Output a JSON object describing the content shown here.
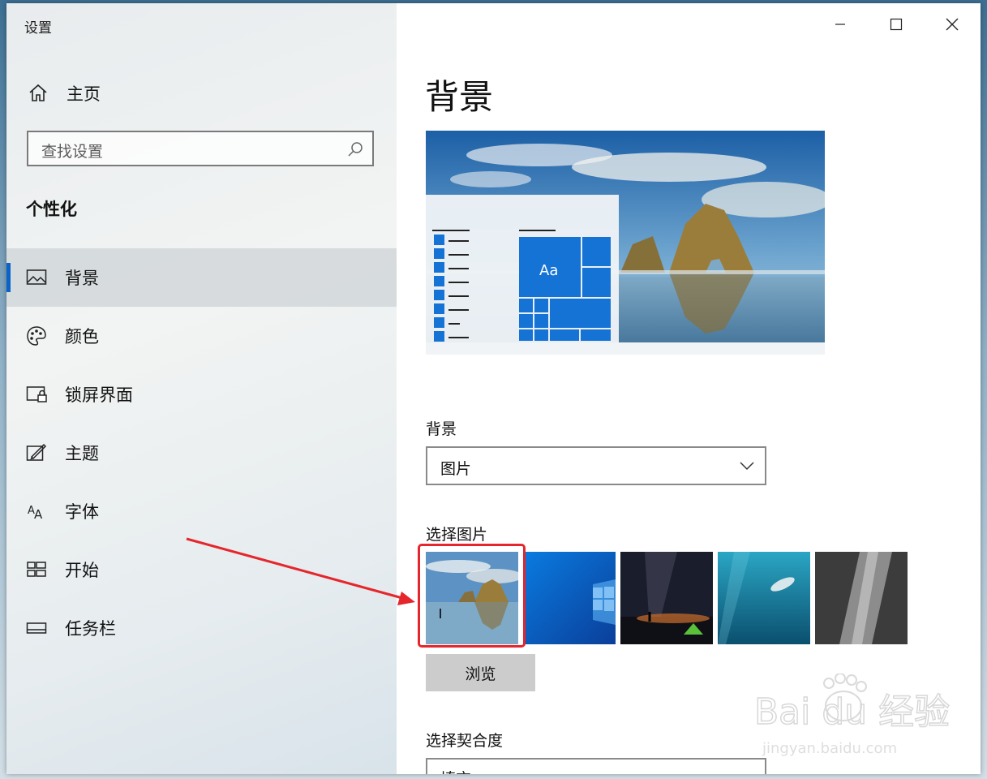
{
  "window": {
    "title": "设置"
  },
  "sidebar": {
    "home_label": "主页",
    "search_placeholder": "查找设置",
    "section_title": "个性化",
    "items": [
      {
        "label": "背景",
        "icon": "picture-icon",
        "selected": true
      },
      {
        "label": "颜色",
        "icon": "palette-icon"
      },
      {
        "label": "锁屏界面",
        "icon": "lock-screen-icon"
      },
      {
        "label": "主题",
        "icon": "theme-brush-icon"
      },
      {
        "label": "字体",
        "icon": "font-icon"
      },
      {
        "label": "开始",
        "icon": "start-icon"
      },
      {
        "label": "任务栏",
        "icon": "taskbar-icon"
      }
    ]
  },
  "main": {
    "page_title": "背景",
    "preview_sample_text": "Aa",
    "background_label": "背景",
    "background_value": "图片",
    "choose_picture_label": "选择图片",
    "pictures": [
      "beach-rocks",
      "windows-blue",
      "night-sky-tent",
      "underwater-swimmer",
      "rock-face"
    ],
    "selected_picture_index": 0,
    "browse_label": "浏览",
    "fit_label": "选择契合度",
    "fit_value": "填充"
  },
  "watermark": {
    "text": "Bai du 经验",
    "subtext": "jingyan.baidu.com"
  },
  "colors": {
    "accent": "#0a63c9",
    "annotation": "#e5262c"
  }
}
